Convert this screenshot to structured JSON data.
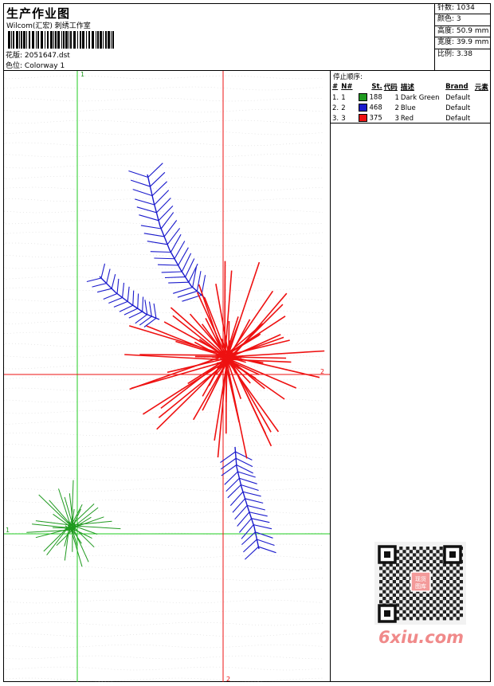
{
  "header": {
    "title": "生产作业图",
    "subtitle": "Wilcom(汇宏) 刺绣工作室",
    "design_label": "花版:",
    "design_value": "2051647.dst",
    "colorway_label": "色位:",
    "colorway_value": "Colorway 1"
  },
  "stats": [
    {
      "label": "针数:",
      "value": "1034"
    },
    {
      "label": "颜色:",
      "value": "3"
    },
    {
      "label": "高度:",
      "value": "50.9 mm"
    },
    {
      "label": "宽度:",
      "value": "39.9 mm"
    },
    {
      "label": "比例:",
      "value": "3.38"
    }
  ],
  "stops": {
    "title": "停止顺序:",
    "columns": [
      "#",
      "N#",
      "St.",
      "代码",
      "描述",
      "Brand",
      "元素"
    ],
    "rows": [
      {
        "idx": "1.",
        "n": "1",
        "color": "#1f9a1f",
        "st": "188",
        "code": "1",
        "desc": "Dark Green",
        "brand": "Default"
      },
      {
        "idx": "2.",
        "n": "2",
        "color": "#1a1acc",
        "st": "468",
        "code": "2",
        "desc": "Blue",
        "brand": "Default"
      },
      {
        "idx": "3.",
        "n": "3",
        "color": "#ee1111",
        "st": "375",
        "code": "3",
        "desc": "Red",
        "brand": "Default"
      }
    ]
  },
  "guides": {
    "green_label": "1",
    "red_label": "2"
  },
  "watermark": {
    "text": "6xiu.com",
    "qr_text": "现货图库"
  },
  "colors": {
    "green": "#1f9a1f",
    "blue": "#1a1acc",
    "red": "#ee1111"
  }
}
